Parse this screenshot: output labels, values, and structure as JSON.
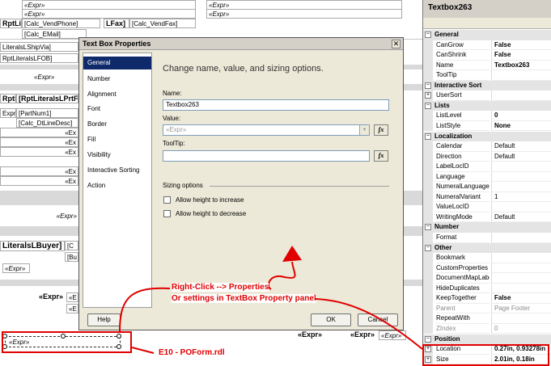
{
  "designer": {
    "row1_left": "«Expr»",
    "row1_right": "«Expr»",
    "vend_phone": "[Calc_VendPhone]",
    "lfax": "LFax]",
    "vend_fax": "[Calc_VendFax]",
    "email": "[Calc_EMail]",
    "literals_ship": "LiteralsLShipVia]",
    "calc_short": "[Calc",
    "literals_fob": "RptLiteralsLFOB]",
    "rptlit_short": "RptLite",
    "expr_italic1": "«Expr»",
    "hdr_rptl": "RptL",
    "hdr_rptlit": "[RptLiteralsLPrtF",
    "part_num": "[PartNum1]",
    "expr_left_partial": "Expr»",
    "dtl_desc": "[Calc_DtLineDesc]",
    "ex1": "«Ex",
    "ex2": "«Ex",
    "ex3": "«Ex",
    "ex4": "«Ex",
    "ex5": "«Ex",
    "expr_italic2": "«Expr»",
    "literals_buyer": "LiteralsLBuyer]",
    "buyer_c": "[C",
    "buyer_bu": "[Bu",
    "expr_small": "«Expr»",
    "expr_bold1": "«Expr»",
    "expr_e": "«E",
    "expr_e2": "«E",
    "expr_bottom1": "«Expr»",
    "expr_bottom2": "«Expr»",
    "expr_bottom3": "«Expr»",
    "expr_sel": "«Expr»",
    "right_top_expr": "«Expr»",
    "right_top_expr2": "«Expr»"
  },
  "props": {
    "title": "Textbox263",
    "rows": [
      {
        "type": "cat",
        "label": "General",
        "exp": "−"
      },
      {
        "type": "prop",
        "name": "CanGrow",
        "value": "False",
        "style": "b"
      },
      {
        "type": "prop",
        "name": "CanShrink",
        "value": "False",
        "style": "b"
      },
      {
        "type": "prop",
        "name": "Name",
        "value": "Textbox263",
        "style": "b"
      },
      {
        "type": "prop",
        "name": "ToolTip",
        "value": "",
        "style": ""
      },
      {
        "type": "cat",
        "label": "Interactive Sort",
        "exp": "−"
      },
      {
        "type": "prop",
        "name": "UserSort",
        "value": "",
        "style": "",
        "exp": "+"
      },
      {
        "type": "cat",
        "label": "Lists",
        "exp": "−"
      },
      {
        "type": "prop",
        "name": "ListLevel",
        "value": "0",
        "style": "b"
      },
      {
        "type": "prop",
        "name": "ListStyle",
        "value": "None",
        "style": "b"
      },
      {
        "type": "cat",
        "label": "Localization",
        "exp": "−"
      },
      {
        "type": "prop",
        "name": "Calendar",
        "value": "Default",
        "style": ""
      },
      {
        "type": "prop",
        "name": "Direction",
        "value": "Default",
        "style": ""
      },
      {
        "type": "prop",
        "name": "LabelLocID",
        "value": "",
        "style": ""
      },
      {
        "type": "prop",
        "name": "Language",
        "value": "",
        "style": ""
      },
      {
        "type": "prop",
        "name": "NumeralLanguage",
        "value": "",
        "style": ""
      },
      {
        "type": "prop",
        "name": "NumeralVariant",
        "value": "1",
        "style": ""
      },
      {
        "type": "prop",
        "name": "ValueLocID",
        "value": "",
        "style": ""
      },
      {
        "type": "prop",
        "name": "WritingMode",
        "value": "Default",
        "style": ""
      },
      {
        "type": "cat",
        "label": "Number",
        "exp": "−"
      },
      {
        "type": "prop",
        "name": "Format",
        "value": "",
        "style": ""
      },
      {
        "type": "cat",
        "label": "Other",
        "exp": "−"
      },
      {
        "type": "prop",
        "name": "Bookmark",
        "value": "",
        "style": ""
      },
      {
        "type": "prop",
        "name": "CustomProperties",
        "value": "",
        "style": ""
      },
      {
        "type": "prop",
        "name": "DocumentMapLabel",
        "value": "",
        "style": ""
      },
      {
        "type": "prop",
        "name": "HideDuplicates",
        "value": "",
        "style": ""
      },
      {
        "type": "prop",
        "name": "KeepTogether",
        "value": "False",
        "style": "b"
      },
      {
        "type": "prop",
        "name": "Parent",
        "value": "Page Footer",
        "style": "gray",
        "nameGray": true
      },
      {
        "type": "prop",
        "name": "RepeatWith",
        "value": "",
        "style": ""
      },
      {
        "type": "prop",
        "name": "ZIndex",
        "value": "0",
        "style": "gray",
        "nameGray": true
      },
      {
        "type": "cat",
        "label": "Position",
        "exp": "−"
      },
      {
        "type": "prop",
        "name": "Location",
        "value": "0.27in, 0.93278in",
        "style": "b",
        "exp": "+"
      },
      {
        "type": "prop",
        "name": "Size",
        "value": "2.01in, 0.18in",
        "style": "b",
        "exp": "+"
      }
    ]
  },
  "dialog": {
    "title": "Text Box Properties",
    "close_glyph": "✕",
    "nav": [
      "General",
      "Number",
      "Alignment",
      "Font",
      "Border",
      "Fill",
      "Visibility",
      "Interactive Sorting",
      "Action"
    ],
    "heading": "Change name, value, and sizing options.",
    "name_label": "Name:",
    "name_value": "Textbox263",
    "value_label": "Value:",
    "value_placeholder": "«Expr»",
    "tooltip_label": "ToolTip:",
    "fx": "fx",
    "arrow": "▼",
    "sizing_label": "Sizing options",
    "chk_increase": "Allow height to increase",
    "chk_decrease": "Allow height to decrease",
    "help": "Help",
    "ok": "OK",
    "cancel": "Cancel"
  },
  "annotations": {
    "line1": "Right-Click --> Properties",
    "line2": "Or settings in TextBox Property panel",
    "file": "E10 - POForm.rdl"
  },
  "colors": {
    "annotation": "#e00000",
    "nav_selected": "#0f2a6b"
  }
}
